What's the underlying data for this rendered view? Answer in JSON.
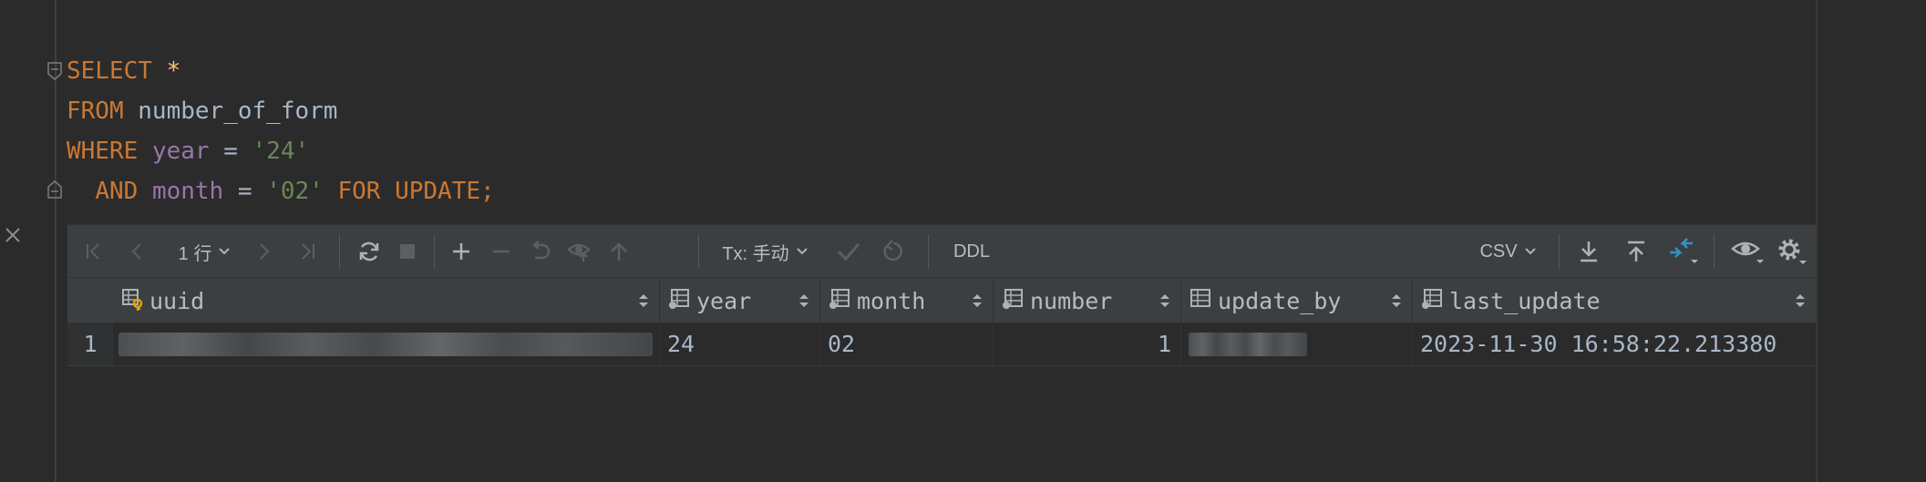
{
  "editor": {
    "tokens": {
      "select": "SELECT",
      "star": "*",
      "from": "FROM",
      "table": "number_of_form",
      "where": "WHERE",
      "col_year": "year",
      "eq1": "=",
      "val_year": "'24'",
      "and": "AND",
      "col_month": "month",
      "eq2": "=",
      "val_month": "'02'",
      "for_update": "FOR UPDATE;"
    }
  },
  "toolbar": {
    "rows_label": "1 行",
    "tx_label": "Tx: 手动",
    "ddl_label": "DDL",
    "export_format": "CSV"
  },
  "grid": {
    "columns": [
      {
        "name": "uuid",
        "icon": "primary-key-column-icon"
      },
      {
        "name": "year",
        "icon": "column-icon"
      },
      {
        "name": "month",
        "icon": "column-icon"
      },
      {
        "name": "number",
        "icon": "column-icon"
      },
      {
        "name": "update_by",
        "icon": "column-icon"
      },
      {
        "name": "last_update",
        "icon": "column-icon"
      }
    ],
    "rows": [
      {
        "row_number": "1",
        "uuid": "",
        "year": "24",
        "month": "02",
        "number": "1",
        "update_by": "",
        "last_update": "2023-11-30 16:58:22.213380"
      }
    ]
  },
  "colors": {
    "background": "#2b2b2b",
    "keyword": "#cc7832",
    "identifier": "#9876aa",
    "string": "#6a8759",
    "text": "#a9b7c6",
    "accent": "#3592c4"
  }
}
